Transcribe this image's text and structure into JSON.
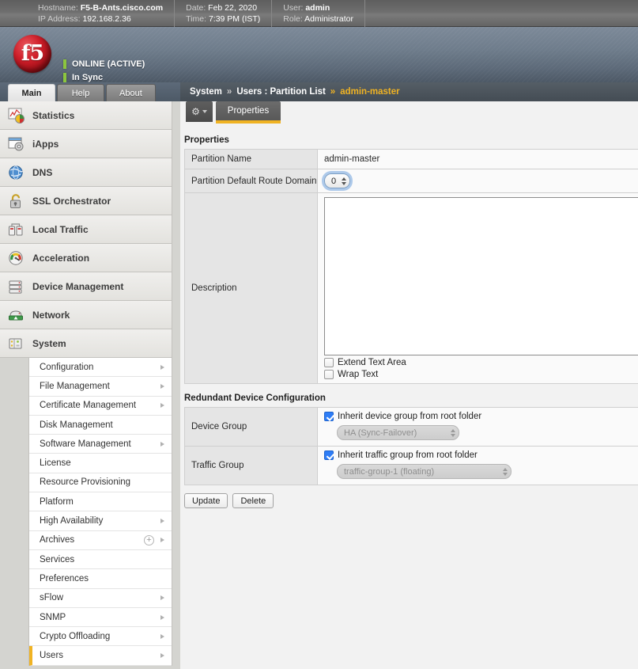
{
  "infobar": {
    "groups": [
      {
        "rows": [
          {
            "key": "Hostname:",
            "value": "F5-B-Ants.cisco.com",
            "bold": true
          },
          {
            "key": "IP Address:",
            "value": "192.168.2.36",
            "bold": false
          }
        ]
      },
      {
        "rows": [
          {
            "key": "Date:",
            "value": "Feb 22, 2020",
            "bold": false
          },
          {
            "key": "Time:",
            "value": "7:39 PM (IST)",
            "bold": false
          }
        ]
      },
      {
        "rows": [
          {
            "key": "User:",
            "value": "admin",
            "bold": true
          },
          {
            "key": "Role:",
            "value": "Administrator",
            "bold": false
          }
        ]
      }
    ]
  },
  "brand": {
    "logo_text": "f5",
    "logo_icon": "f5-ball-logo",
    "status_primary": "ONLINE (ACTIVE)",
    "status_secondary": "In Sync",
    "status_color": "#8cc63e"
  },
  "top_tabs": [
    {
      "label": "Main",
      "active": true
    },
    {
      "label": "Help",
      "active": false
    },
    {
      "label": "About",
      "active": false
    }
  ],
  "breadcrumb": {
    "items": [
      "System",
      "Users : Partition List",
      "admin-master"
    ],
    "separator": "»",
    "active_color": "#f0b323"
  },
  "subtabs": {
    "gear_icon": "gear-icon",
    "tabs": [
      {
        "label": "Properties",
        "active": true
      }
    ]
  },
  "sidebar": {
    "items": [
      {
        "label": "Statistics",
        "icon": "statistics-chart-icon"
      },
      {
        "label": "iApps",
        "icon": "iapps-window-gear-icon"
      },
      {
        "label": "DNS",
        "icon": "dns-globe-icon"
      },
      {
        "label": "SSL Orchestrator",
        "icon": "ssl-padlock-icon"
      },
      {
        "label": "Local Traffic",
        "icon": "local-traffic-servers-icon"
      },
      {
        "label": "Acceleration",
        "icon": "acceleration-gauge-icon"
      },
      {
        "label": "Device Management",
        "icon": "device-management-stack-icon"
      },
      {
        "label": "Network",
        "icon": "network-device-icon"
      },
      {
        "label": "System",
        "icon": "system-panel-icon"
      }
    ],
    "system_submenu": [
      {
        "label": "Configuration",
        "arrow": true,
        "plus": false,
        "active": false
      },
      {
        "label": "File Management",
        "arrow": true,
        "plus": false,
        "active": false
      },
      {
        "label": "Certificate Management",
        "arrow": true,
        "plus": false,
        "active": false
      },
      {
        "label": "Disk Management",
        "arrow": false,
        "plus": false,
        "active": false
      },
      {
        "label": "Software Management",
        "arrow": true,
        "plus": false,
        "active": false
      },
      {
        "label": "License",
        "arrow": false,
        "plus": false,
        "active": false
      },
      {
        "label": "Resource Provisioning",
        "arrow": false,
        "plus": false,
        "active": false
      },
      {
        "label": "Platform",
        "arrow": false,
        "plus": false,
        "active": false
      },
      {
        "label": "High Availability",
        "arrow": true,
        "plus": false,
        "active": false
      },
      {
        "label": "Archives",
        "arrow": true,
        "plus": true,
        "active": false
      },
      {
        "label": "Services",
        "arrow": false,
        "plus": false,
        "active": false
      },
      {
        "label": "Preferences",
        "arrow": false,
        "plus": false,
        "active": false
      },
      {
        "label": "sFlow",
        "arrow": true,
        "plus": false,
        "active": false
      },
      {
        "label": "SNMP",
        "arrow": true,
        "plus": false,
        "active": false
      },
      {
        "label": "Crypto Offloading",
        "arrow": true,
        "plus": false,
        "active": false
      },
      {
        "label": "Users",
        "arrow": true,
        "plus": false,
        "active": true
      }
    ]
  },
  "main": {
    "properties_section": {
      "title": "Properties",
      "partition_name_label": "Partition Name",
      "partition_name_value": "admin-master",
      "route_domain_label": "Partition Default Route Domain",
      "route_domain_value": "0",
      "description_label": "Description",
      "description_value": "",
      "description_placeholder": "",
      "extend_text_area_label": "Extend Text Area",
      "extend_text_area_checked": false,
      "wrap_text_label": "Wrap Text",
      "wrap_text_checked": false
    },
    "redundant_section": {
      "title": "Redundant Device Configuration",
      "device_group_label": "Device Group",
      "device_group_inherit_label": "Inherit device group from root folder",
      "device_group_inherit_checked": true,
      "device_group_value": "HA (Sync-Failover)",
      "traffic_group_label": "Traffic Group",
      "traffic_group_inherit_label": "Inherit traffic group from root folder",
      "traffic_group_inherit_checked": true,
      "traffic_group_value": "traffic-group-1 (floating)"
    },
    "buttons": [
      {
        "label": "Update"
      },
      {
        "label": "Delete"
      }
    ]
  }
}
